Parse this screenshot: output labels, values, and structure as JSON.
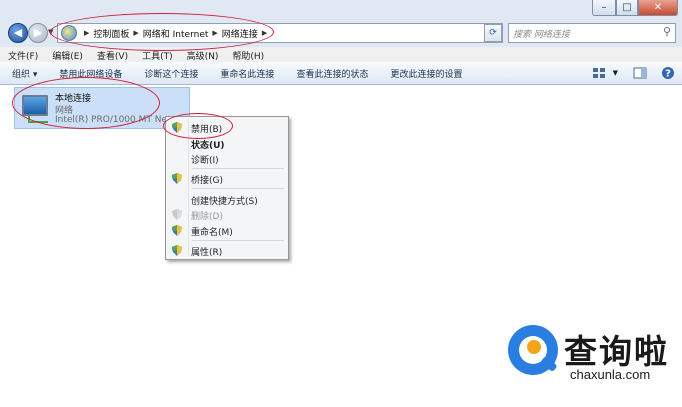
{
  "window": {
    "controls": {
      "minimize": "–",
      "maximize": "□",
      "close": "✕"
    }
  },
  "address_bar": {
    "crumbs": [
      "控制面板",
      "网络和 Internet",
      "网络连接"
    ],
    "search_placeholder": "搜索 网络连接"
  },
  "menu": [
    "文件(F)",
    "编辑(E)",
    "查看(V)",
    "工具(T)",
    "高级(N)",
    "帮助(H)"
  ],
  "toolbar": {
    "items": [
      "组织 ▾",
      "禁用此网络设备",
      "诊断这个连接",
      "重命名此连接",
      "查看此连接的状态",
      "更改此连接的设置"
    ]
  },
  "connection": {
    "name": "本地连接",
    "status": "网络",
    "device": "Intel(R) PRO/1000 MT Network Connection"
  },
  "context_menu": {
    "items": [
      {
        "label": "禁用(B)",
        "shield": true,
        "bold": false,
        "disabled": false
      },
      {
        "label": "状态(U)",
        "shield": false,
        "bold": true,
        "disabled": false
      },
      {
        "label": "诊断(I)",
        "shield": false,
        "bold": false,
        "disabled": false
      },
      {
        "label": "桥接(G)",
        "shield": true,
        "bold": false,
        "disabled": false
      },
      {
        "label": "创建快捷方式(S)",
        "shield": false,
        "bold": false,
        "disabled": false
      },
      {
        "label": "删除(D)",
        "shield": true,
        "bold": false,
        "disabled": true
      },
      {
        "label": "重命名(M)",
        "shield": true,
        "bold": false,
        "disabled": false
      },
      {
        "label": "属性(R)",
        "shield": true,
        "bold": false,
        "disabled": false
      }
    ]
  },
  "watermark": {
    "cn": "查询啦",
    "en": "chaxunla.com"
  },
  "colors": {
    "annotation": "#d11e3a",
    "selection": "#cbe0f8",
    "logo_blue": "#2a7de1",
    "logo_orange": "#f2a51a"
  }
}
